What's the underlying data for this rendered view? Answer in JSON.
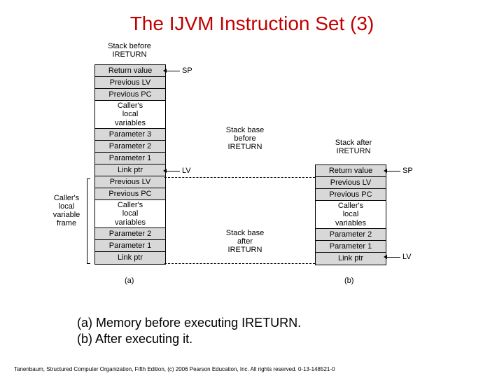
{
  "title": "The IJVM Instruction Set (3)",
  "labels": {
    "stack_before_header": "Stack before\nIRETURN",
    "stack_base_before": "Stack base\nbefore\nIRETURN",
    "stack_after_header": "Stack after\nIRETURN",
    "stack_base_after": "Stack base\nafter\nIRETURN",
    "callers_frame": "Caller's\nlocal\nvariable\nframe",
    "sp": "SP",
    "lv": "LV",
    "fig_a": "(a)",
    "fig_b": "(b)"
  },
  "cells": {
    "return_value": "Return value",
    "previous_lv": "Previous LV",
    "previous_pc": "Previous PC",
    "callers_locals": "Caller's\nlocal\nvariables",
    "param3": "Parameter 3",
    "param2": "Parameter 2",
    "param1": "Parameter 1",
    "link_ptr": "Link ptr"
  },
  "caption_a": "(a) Memory before executing IRETURN.",
  "caption_b": "(b) After executing it.",
  "footer": "Tanenbaum, Structured Computer Organization, Fifth Edition, (c) 2006 Pearson Education, Inc. All rights reserved. 0-13-148521-0"
}
